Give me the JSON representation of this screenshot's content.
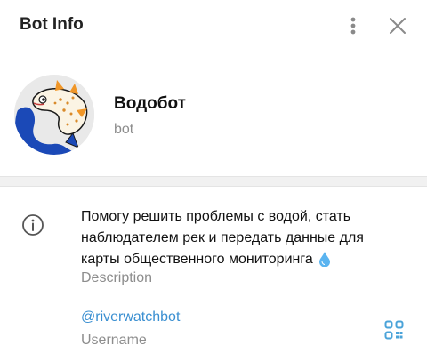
{
  "header": {
    "title": "Bot Info",
    "more_icon": "more-vertical-icon",
    "close_icon": "close-icon"
  },
  "profile": {
    "name": "Водобот",
    "status": "bot",
    "avatar_icon": "fish-avatar"
  },
  "description": {
    "icon": "info-icon",
    "text": "Помогу решить проблемы с водой, стать наблюдателем рек и передать данные для карты общественного мониторинга",
    "emoji_icon": "water-drop-icon",
    "label": "Description"
  },
  "username": {
    "value": "@riverwatchbot",
    "label": "Username",
    "qr_icon": "qr-code-icon"
  },
  "colors": {
    "link": "#3a8fd1",
    "secondary_text": "#8d8d8d",
    "divider": "#f1f1f1",
    "icon": "#7a7a7a",
    "qr": "#4aa3d9"
  }
}
